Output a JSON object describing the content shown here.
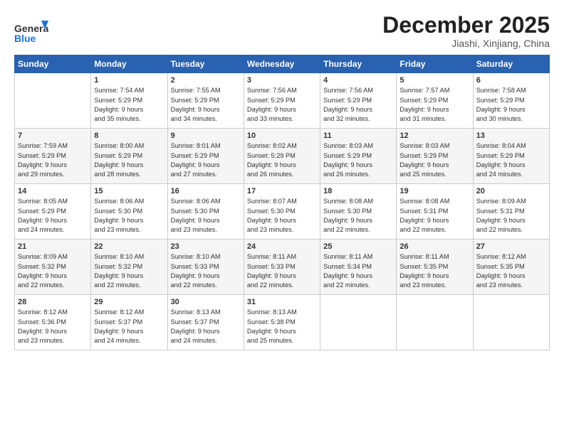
{
  "header": {
    "logo_general": "General",
    "logo_blue": "Blue",
    "month_year": "December 2025",
    "location": "Jiashi, Xinjiang, China"
  },
  "days_of_week": [
    "Sunday",
    "Monday",
    "Tuesday",
    "Wednesday",
    "Thursday",
    "Friday",
    "Saturday"
  ],
  "weeks": [
    [
      {
        "day": "",
        "content": ""
      },
      {
        "day": "1",
        "content": "Sunrise: 7:54 AM\nSunset: 5:29 PM\nDaylight: 9 hours\nand 35 minutes."
      },
      {
        "day": "2",
        "content": "Sunrise: 7:55 AM\nSunset: 5:29 PM\nDaylight: 9 hours\nand 34 minutes."
      },
      {
        "day": "3",
        "content": "Sunrise: 7:56 AM\nSunset: 5:29 PM\nDaylight: 9 hours\nand 33 minutes."
      },
      {
        "day": "4",
        "content": "Sunrise: 7:56 AM\nSunset: 5:29 PM\nDaylight: 9 hours\nand 32 minutes."
      },
      {
        "day": "5",
        "content": "Sunrise: 7:57 AM\nSunset: 5:29 PM\nDaylight: 9 hours\nand 31 minutes."
      },
      {
        "day": "6",
        "content": "Sunrise: 7:58 AM\nSunset: 5:29 PM\nDaylight: 9 hours\nand 30 minutes."
      }
    ],
    [
      {
        "day": "7",
        "content": "Sunrise: 7:59 AM\nSunset: 5:29 PM\nDaylight: 9 hours\nand 29 minutes."
      },
      {
        "day": "8",
        "content": "Sunrise: 8:00 AM\nSunset: 5:29 PM\nDaylight: 9 hours\nand 28 minutes."
      },
      {
        "day": "9",
        "content": "Sunrise: 8:01 AM\nSunset: 5:29 PM\nDaylight: 9 hours\nand 27 minutes."
      },
      {
        "day": "10",
        "content": "Sunrise: 8:02 AM\nSunset: 5:29 PM\nDaylight: 9 hours\nand 26 minutes."
      },
      {
        "day": "11",
        "content": "Sunrise: 8:03 AM\nSunset: 5:29 PM\nDaylight: 9 hours\nand 26 minutes."
      },
      {
        "day": "12",
        "content": "Sunrise: 8:03 AM\nSunset: 5:29 PM\nDaylight: 9 hours\nand 25 minutes."
      },
      {
        "day": "13",
        "content": "Sunrise: 8:04 AM\nSunset: 5:29 PM\nDaylight: 9 hours\nand 24 minutes."
      }
    ],
    [
      {
        "day": "14",
        "content": "Sunrise: 8:05 AM\nSunset: 5:29 PM\nDaylight: 9 hours\nand 24 minutes."
      },
      {
        "day": "15",
        "content": "Sunrise: 8:06 AM\nSunset: 5:30 PM\nDaylight: 9 hours\nand 23 minutes."
      },
      {
        "day": "16",
        "content": "Sunrise: 8:06 AM\nSunset: 5:30 PM\nDaylight: 9 hours\nand 23 minutes."
      },
      {
        "day": "17",
        "content": "Sunrise: 8:07 AM\nSunset: 5:30 PM\nDaylight: 9 hours\nand 23 minutes."
      },
      {
        "day": "18",
        "content": "Sunrise: 8:08 AM\nSunset: 5:30 PM\nDaylight: 9 hours\nand 22 minutes."
      },
      {
        "day": "19",
        "content": "Sunrise: 8:08 AM\nSunset: 5:31 PM\nDaylight: 9 hours\nand 22 minutes."
      },
      {
        "day": "20",
        "content": "Sunrise: 8:09 AM\nSunset: 5:31 PM\nDaylight: 9 hours\nand 22 minutes."
      }
    ],
    [
      {
        "day": "21",
        "content": "Sunrise: 8:09 AM\nSunset: 5:32 PM\nDaylight: 9 hours\nand 22 minutes."
      },
      {
        "day": "22",
        "content": "Sunrise: 8:10 AM\nSunset: 5:32 PM\nDaylight: 9 hours\nand 22 minutes."
      },
      {
        "day": "23",
        "content": "Sunrise: 8:10 AM\nSunset: 5:33 PM\nDaylight: 9 hours\nand 22 minutes."
      },
      {
        "day": "24",
        "content": "Sunrise: 8:11 AM\nSunset: 5:33 PM\nDaylight: 9 hours\nand 22 minutes."
      },
      {
        "day": "25",
        "content": "Sunrise: 8:11 AM\nSunset: 5:34 PM\nDaylight: 9 hours\nand 22 minutes."
      },
      {
        "day": "26",
        "content": "Sunrise: 8:11 AM\nSunset: 5:35 PM\nDaylight: 9 hours\nand 23 minutes."
      },
      {
        "day": "27",
        "content": "Sunrise: 8:12 AM\nSunset: 5:35 PM\nDaylight: 9 hours\nand 23 minutes."
      }
    ],
    [
      {
        "day": "28",
        "content": "Sunrise: 8:12 AM\nSunset: 5:36 PM\nDaylight: 9 hours\nand 23 minutes."
      },
      {
        "day": "29",
        "content": "Sunrise: 8:12 AM\nSunset: 5:37 PM\nDaylight: 9 hours\nand 24 minutes."
      },
      {
        "day": "30",
        "content": "Sunrise: 8:13 AM\nSunset: 5:37 PM\nDaylight: 9 hours\nand 24 minutes."
      },
      {
        "day": "31",
        "content": "Sunrise: 8:13 AM\nSunset: 5:38 PM\nDaylight: 9 hours\nand 25 minutes."
      },
      {
        "day": "",
        "content": ""
      },
      {
        "day": "",
        "content": ""
      },
      {
        "day": "",
        "content": ""
      }
    ]
  ]
}
